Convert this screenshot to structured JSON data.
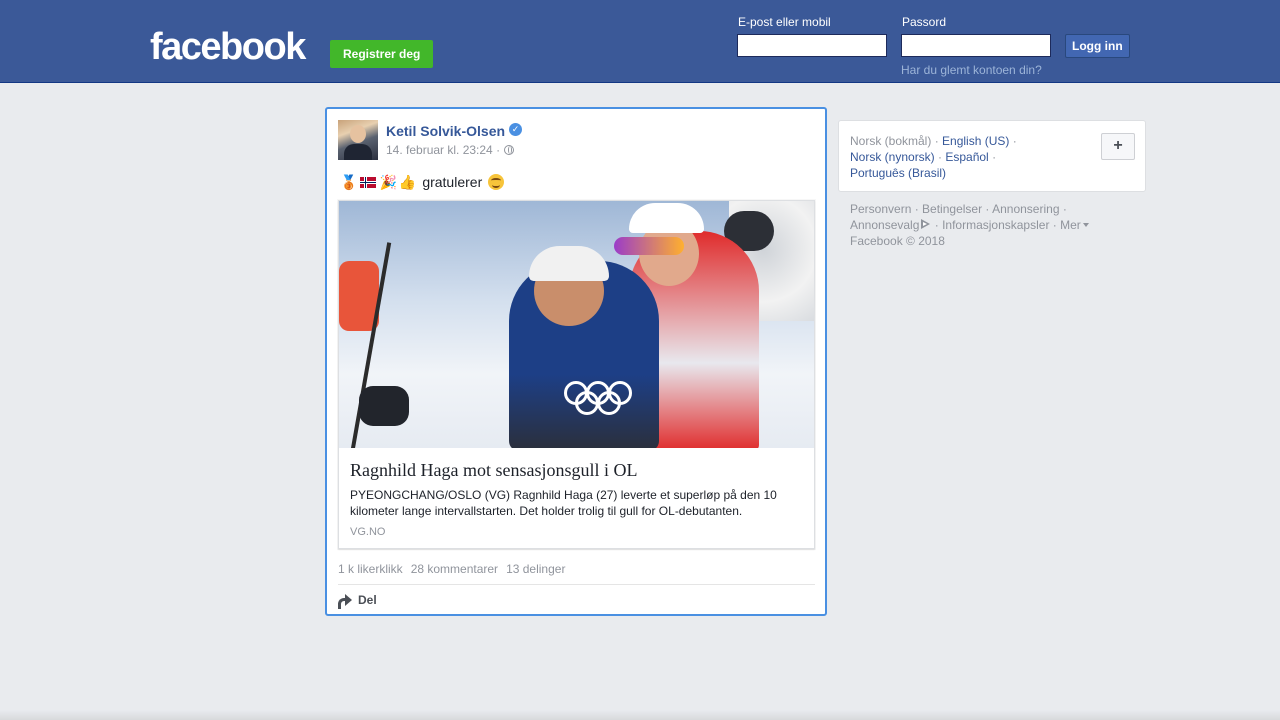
{
  "header": {
    "logo": "facebook",
    "register_label": "Registrer deg",
    "email_label": "E-post eller mobil",
    "email_value": "",
    "password_label": "Passord",
    "password_value": "",
    "login_label": "Logg inn",
    "forgot_label": "Har du glemt kontoen din?",
    "brand_color": "#3b5998"
  },
  "post": {
    "author": "Ketil Solvik-Olsen",
    "verified_icon": "verified-badge-icon",
    "timestamp": "14. februar kl. 23:24 ·",
    "privacy_icon": "globe-icon",
    "message_emojis_before": "🥉",
    "message_emoji_party": "🎉",
    "message_emoji_thumb": "👍",
    "message_text": "gratulerer",
    "link": {
      "title": "Ragnhild Haga mot sensasjonsgull i OL",
      "description": "PYEONGCHANG/OSLO (VG) Ragnhild Haga (27) leverte et superløp på den 10 kilometer lange intervallstarten. Det holder trolig til gull for OL-debutanten.",
      "source": "VG.NO"
    },
    "stats": {
      "likes": "1 k likerklikk",
      "comments": "28 kommentarer",
      "shares": "13 delinger"
    },
    "share_label": "Del"
  },
  "sidebar": {
    "languages": {
      "current": "Norsk (bokmål)",
      "options": [
        "English (US)",
        "Norsk (nynorsk)",
        "Español",
        "Português (Brasil)"
      ]
    },
    "add_language_label": "+",
    "footer_links": [
      "Personvern",
      "Betingelser",
      "Annonsering",
      "Annonsevalg",
      "Informasjonskapsler",
      "Mer"
    ],
    "copyright": "Facebook © 2018"
  }
}
